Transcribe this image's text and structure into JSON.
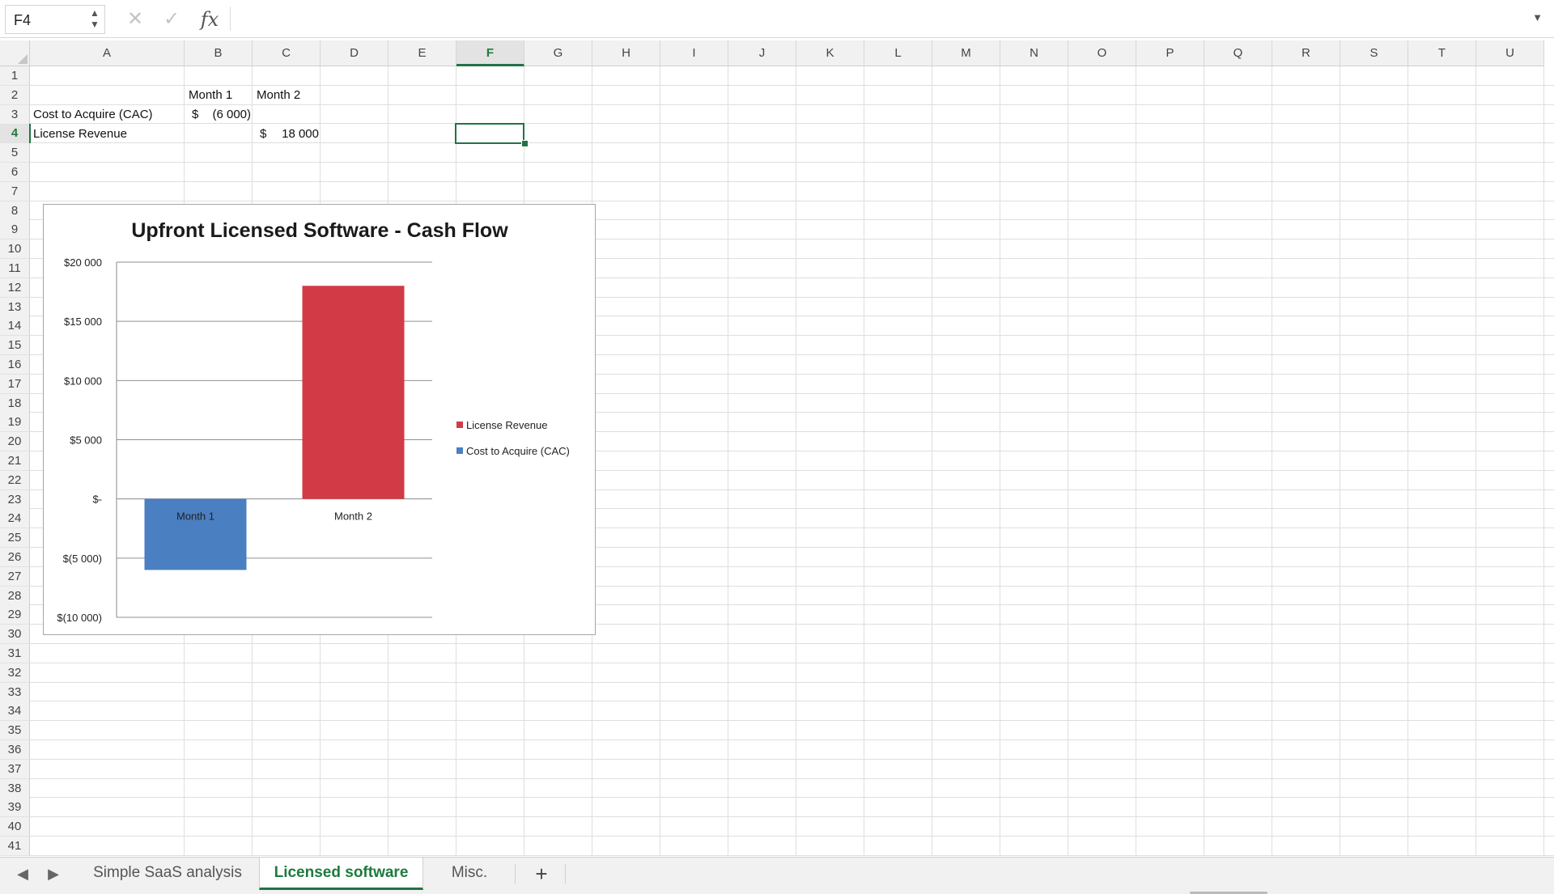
{
  "formula_bar": {
    "name_box": "F4",
    "name_box_arrows": "▲\n▼",
    "cancel_icon": "✕",
    "enter_icon": "✓",
    "fx_label": "fx",
    "formula": "",
    "expand_icon": "▼"
  },
  "grid": {
    "columns": [
      "A",
      "B",
      "C",
      "D",
      "E",
      "F",
      "G",
      "H",
      "I",
      "J",
      "K",
      "L",
      "M",
      "N",
      "O",
      "P",
      "Q",
      "R",
      "S",
      "T",
      "U"
    ],
    "selected_column": "F",
    "rows": [
      "1",
      "2",
      "3",
      "4",
      "5",
      "6",
      "7",
      "8",
      "9",
      "10",
      "11",
      "12",
      "13",
      "14",
      "15",
      "16",
      "17",
      "18",
      "19",
      "20",
      "21",
      "22",
      "23",
      "24",
      "25",
      "26",
      "27",
      "28",
      "29",
      "30",
      "31",
      "32",
      "33",
      "34",
      "35",
      "36",
      "37",
      "38",
      "39",
      "40",
      "41"
    ],
    "selected_row": "4",
    "active_cell": "F4"
  },
  "cells": {
    "B2": "Month 1",
    "C2": "Month 2",
    "A3": "Cost to Acquire (CAC)",
    "B3_currency": "$",
    "B3_value": "(6 000)",
    "A4": "License Revenue",
    "C4_currency": "$",
    "C4_value": "18 000"
  },
  "chart_data": {
    "type": "bar",
    "title": "Upfront Licensed Software - Cash Flow",
    "categories": [
      "Month 1",
      "Month 2"
    ],
    "series": [
      {
        "name": "Cost to Acquire (CAC)",
        "values": [
          -6000,
          0
        ],
        "color": "#4a7fc1"
      },
      {
        "name": "License Revenue",
        "values": [
          0,
          18000
        ],
        "color": "#d23b46"
      }
    ],
    "legend_order": [
      "License Revenue",
      "Cost to Acquire (CAC)"
    ],
    "ylim": [
      -10000,
      20000
    ],
    "yticks": [
      20000,
      15000,
      10000,
      5000,
      0,
      -5000,
      -10000
    ],
    "ytick_labels": [
      "$20 000",
      "$15 000",
      "$10 000",
      "$5 000",
      "$-",
      "$(5 000)",
      "$(10 000)"
    ],
    "legend_position": "right",
    "grid": true
  },
  "sheet_tabs": {
    "prev_icon": "◀",
    "next_icon": "▶",
    "tabs": [
      "Simple SaaS analysis",
      "Licensed software",
      "Misc."
    ],
    "active": "Licensed software",
    "add_icon": "+"
  }
}
